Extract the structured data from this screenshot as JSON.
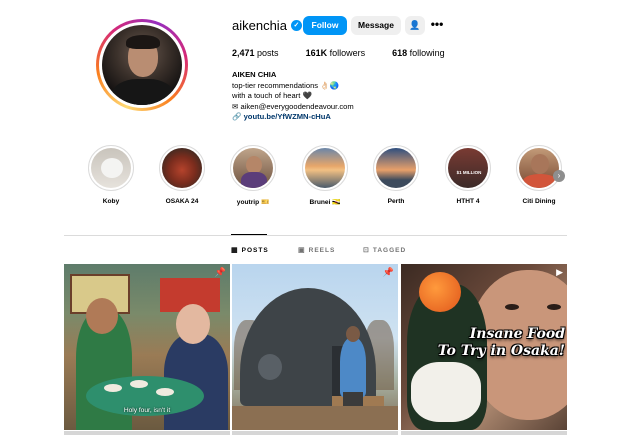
{
  "profile": {
    "username": "aikenchia",
    "verified": true,
    "follow_label": "Follow",
    "message_label": "Message",
    "stats": {
      "posts_value": "2,471",
      "posts_label": "posts",
      "followers_value": "161K",
      "followers_label": "followers",
      "following_value": "618",
      "following_label": "following"
    },
    "bio": {
      "name": "AIKEN CHIA",
      "line1": "top-tier recommendations 👌🏻🌏",
      "line2": "with a touch of heart 🖤",
      "line3": "✉ aiken@everygoodendeavour.com",
      "link": "youtu.be/YfWZMN-cHuA"
    }
  },
  "highlights": [
    {
      "label": "Koby"
    },
    {
      "label": "OSAKA 24"
    },
    {
      "label": "youtrip 🎫"
    },
    {
      "label": "Brunei 🇧🇳"
    },
    {
      "label": "Perth"
    },
    {
      "label": "HTHT 4"
    },
    {
      "label": "Citi Dining"
    }
  ],
  "tabs": [
    {
      "label": "POSTS",
      "icon": "grid-icon",
      "active": true
    },
    {
      "label": "REELS",
      "icon": "reels-icon",
      "active": false
    },
    {
      "label": "TAGGED",
      "icon": "tag-icon",
      "active": false
    }
  ],
  "posts": [
    {
      "caption": "Holy four, isn't it",
      "icon": "pin-icon"
    },
    {
      "caption": "",
      "icon": "pin-icon"
    },
    {
      "title_line1": "Insane Food",
      "title_line2": "To Try in Osaka!",
      "icon": "reel-icon"
    }
  ],
  "highlight_texts": {
    "htht_sign": "$1 MILLION"
  },
  "colors": {
    "accent": "#0095f6",
    "link": "#00376b",
    "button_secondary": "#efefef",
    "divider": "#dbdbdb"
  }
}
